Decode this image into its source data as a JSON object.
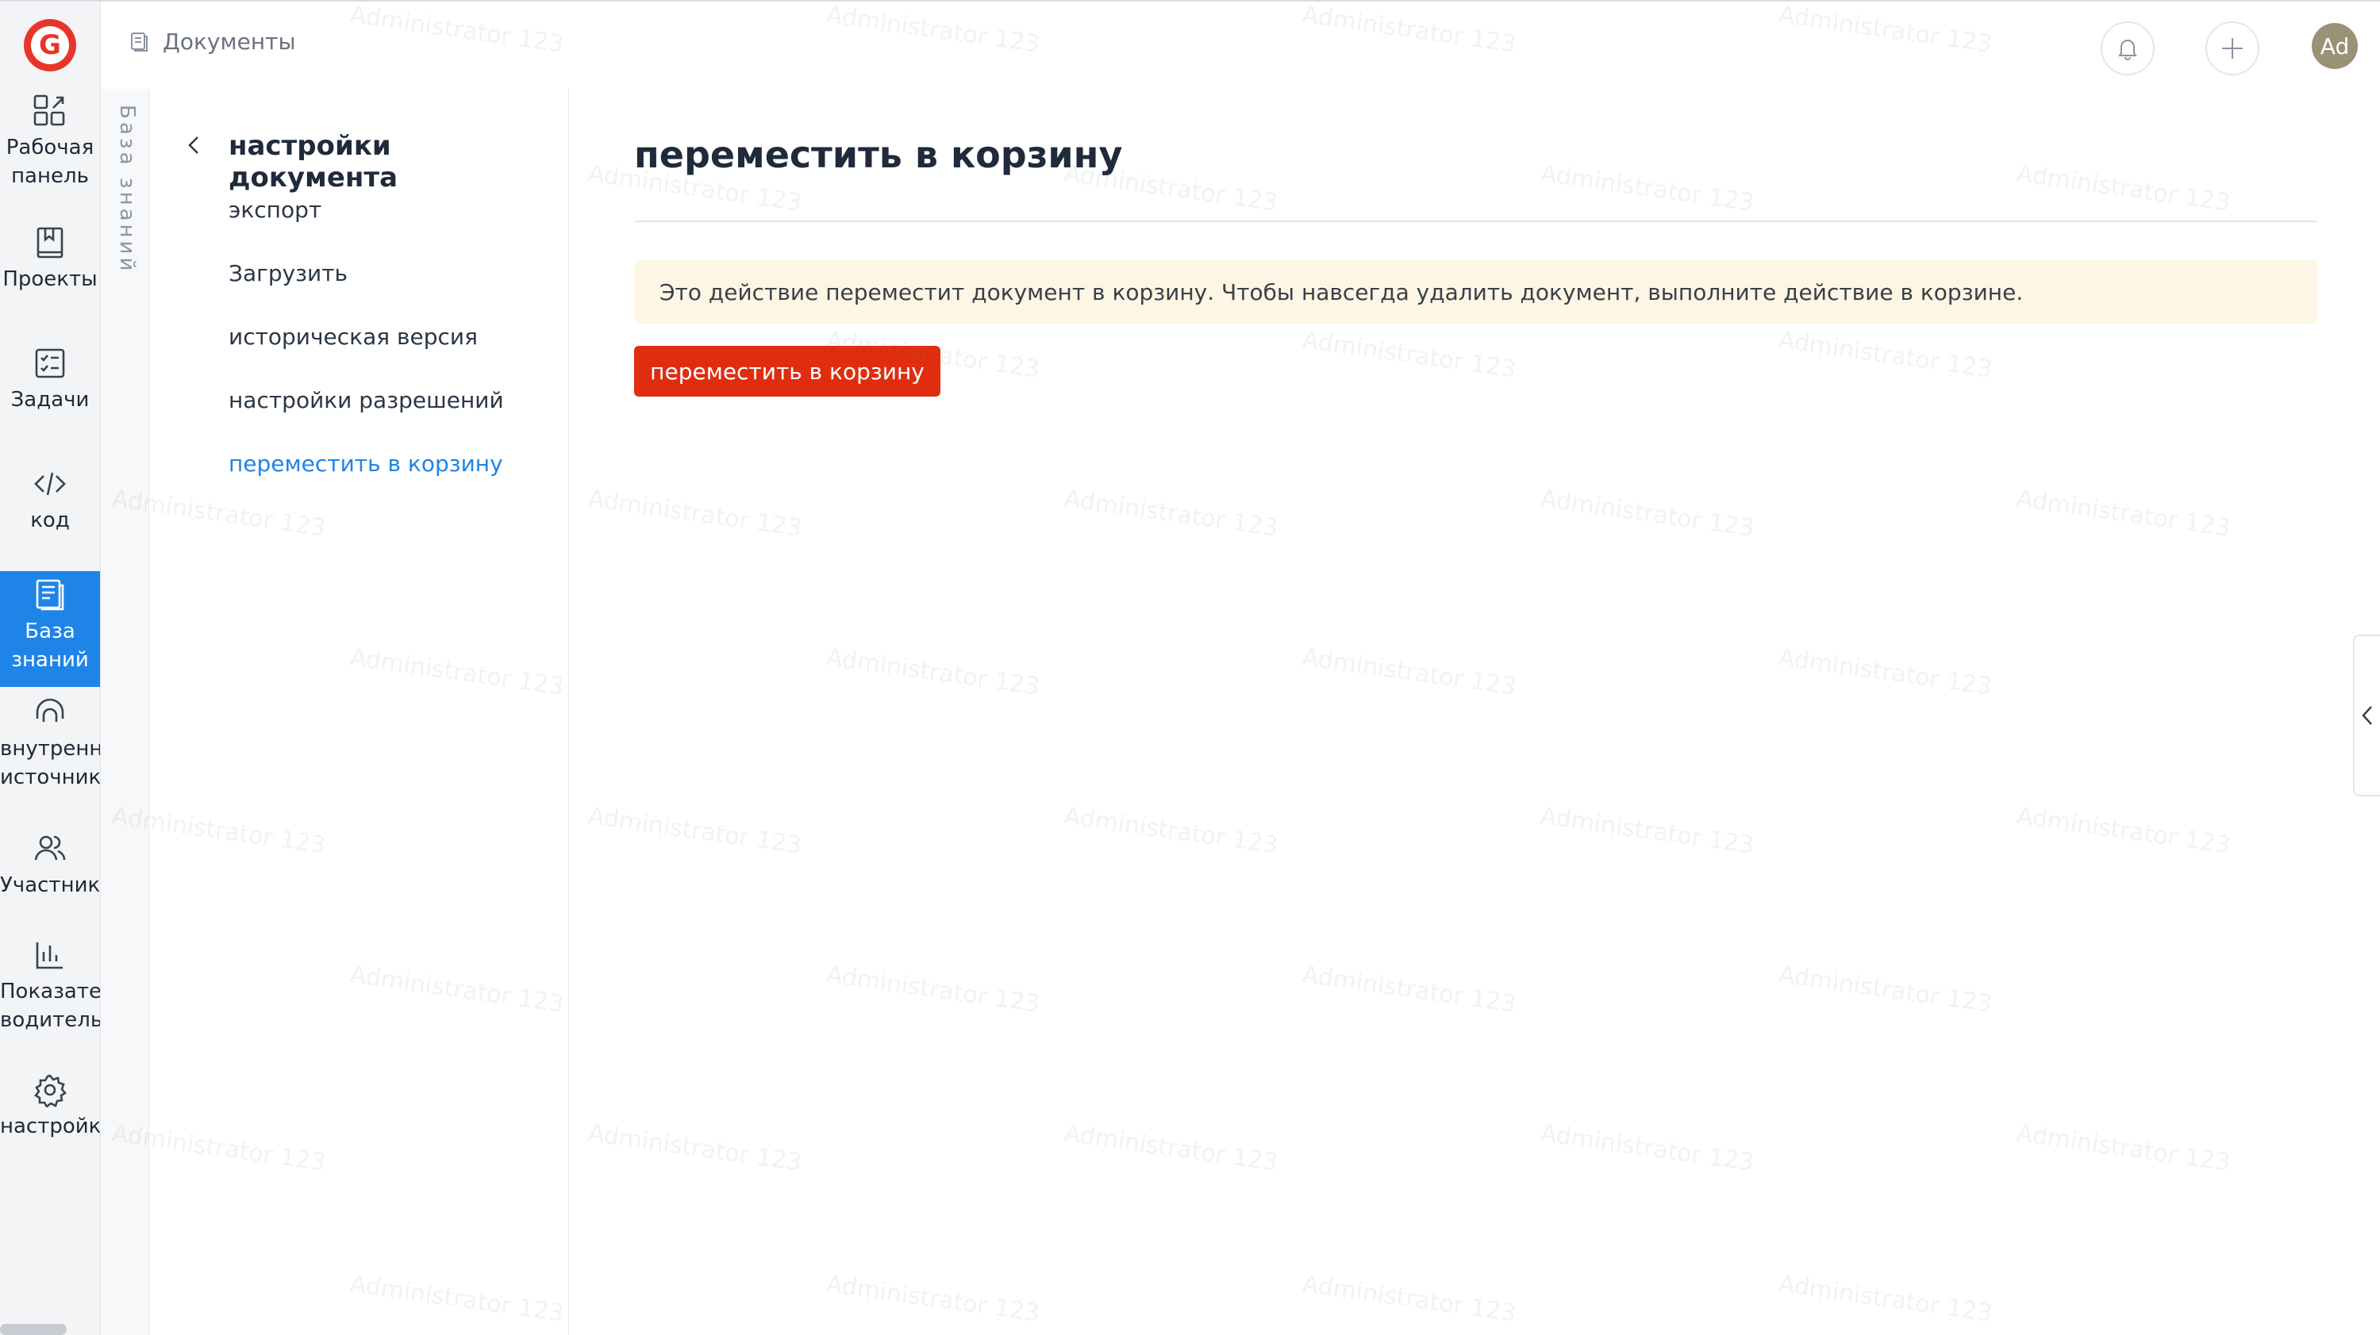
{
  "colors": {
    "accent": "#1f84e8",
    "danger_button": "#e02d0f",
    "notice_bg": "#fdf6e4",
    "logo": "#e8352a",
    "avatar_bg": "#9a9177"
  },
  "logo": {
    "letter": "G",
    "icon": "brand-logo-icon"
  },
  "nav": {
    "items": [
      {
        "icon": "dashboard-icon",
        "label_line1": "Рабочая",
        "label_line2": "панель",
        "active": false
      },
      {
        "icon": "book-icon",
        "label_line1": "Проекты",
        "label_line2": "",
        "active": false
      },
      {
        "icon": "task-list-icon",
        "label_line1": "Задачи",
        "label_line2": "",
        "active": false
      },
      {
        "icon": "code-icon",
        "label_line1": "код",
        "label_line2": "",
        "active": false
      },
      {
        "icon": "document-icon",
        "label_line1": "База",
        "label_line2": "знаний",
        "active": true
      },
      {
        "icon": "headset-icon",
        "label_line1": "внутренни",
        "label_line2": "источник",
        "active": false
      },
      {
        "icon": "users-icon",
        "label_line1": "Участники",
        "label_line2": "",
        "active": false
      },
      {
        "icon": "bar-chart-icon",
        "label_line1": "Показател",
        "label_line2": "водитель",
        "active": false
      },
      {
        "icon": "gear-icon",
        "label_line1": "настройка",
        "label_line2": "",
        "active": false
      }
    ]
  },
  "kb_strip": {
    "label": "База знаний"
  },
  "header": {
    "breadcrumb": "Документы",
    "avatar_text": "Ad"
  },
  "settings": {
    "title": "настройки документа",
    "items": [
      {
        "label": "экспорт",
        "active": false
      },
      {
        "label": "Загрузить",
        "active": false
      },
      {
        "label": "историческая версия",
        "active": false
      },
      {
        "label": "настройки разрешений",
        "active": false
      },
      {
        "label": "переместить в корзину",
        "active": true
      }
    ]
  },
  "main": {
    "title": "переместить в корзину",
    "notice": "Это действие переместит документ в корзину. Чтобы навсегда удалить документ, выполните действие в корзине.",
    "button_label": "переместить в корзину"
  },
  "watermark": {
    "text": "Administrator 123"
  }
}
